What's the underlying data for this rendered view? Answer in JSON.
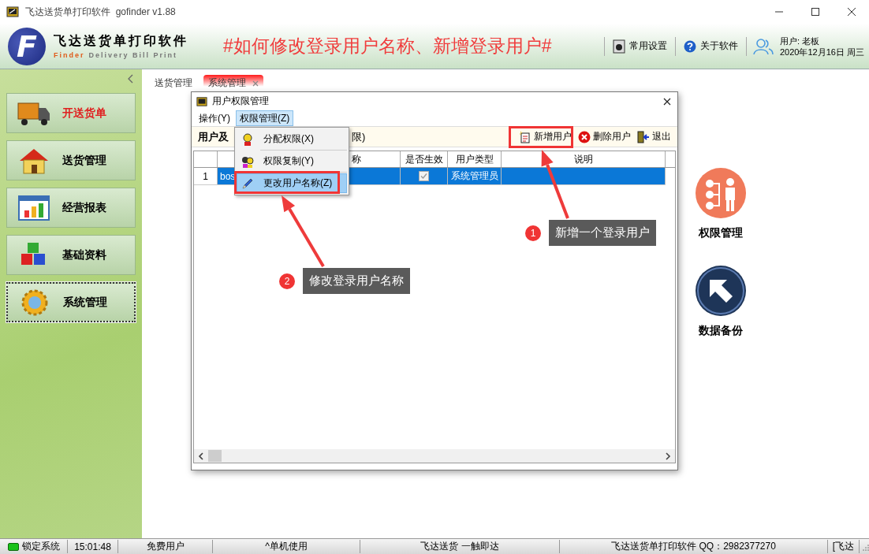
{
  "window": {
    "title": "飞达送货单打印软件  gofinder v1.88"
  },
  "header": {
    "logo_letter": "F",
    "brand_name": "飞达送货单打印软件",
    "brand_tagline_accent": "Finder",
    "brand_tagline": "Delivery Bill Print",
    "headline": "#如何修改登录用户名称、新增登录用户#",
    "tools": [
      {
        "label": "常用设置",
        "kind": "settings"
      },
      {
        "label": "关于软件",
        "kind": "help"
      }
    ],
    "user": "用户: 老板",
    "date": "2020年12月16日 周三"
  },
  "sidebar": {
    "items": [
      {
        "label": "开送货单",
        "kind": "truck",
        "selected": false,
        "color": "#e02020"
      },
      {
        "label": "送货管理",
        "kind": "house",
        "selected": false,
        "color": "#000000"
      },
      {
        "label": "经营报表",
        "kind": "chart",
        "selected": false,
        "color": "#000000"
      },
      {
        "label": "基础资料",
        "kind": "cubes",
        "selected": false,
        "color": "#000000"
      },
      {
        "label": "系统管理",
        "kind": "gear",
        "selected": true,
        "color": "#000000"
      }
    ]
  },
  "tabs": [
    {
      "label": "送货管理",
      "selected": false,
      "closable": false
    },
    {
      "label": "系统管理",
      "selected": true,
      "closable": true
    }
  ],
  "launchers": [
    {
      "label": "权限管理",
      "kind": "permissions"
    },
    {
      "label": "数据备份",
      "kind": "backup"
    }
  ],
  "dialog": {
    "title": "用户权限管理",
    "menus": [
      {
        "label": "操作(Y)",
        "selected": false
      },
      {
        "label": "权限管理(Z)",
        "selected": true
      }
    ],
    "dropdown": [
      {
        "label": "分配权限(X)",
        "kind": "assign",
        "selected": false
      },
      {
        "label": "权限复制(Y)",
        "kind": "copy",
        "selected": false
      },
      {
        "label": "更改用户名称(Z)",
        "kind": "rename",
        "selected": true
      }
    ],
    "toolbar_label": "用户及",
    "toolbar_label_tail": "限)",
    "buttons": [
      {
        "label": "新增用户",
        "kind": "add"
      },
      {
        "label": "删除用户",
        "kind": "delete"
      },
      {
        "label": "退出",
        "kind": "exit"
      }
    ],
    "table": {
      "columns": [
        {
          "kind": "index"
        },
        {
          "kind": "text"
        },
        {
          "kind": "text",
          "label": "称"
        },
        {
          "kind": "check",
          "label": "是否生效"
        },
        {
          "kind": "text",
          "label": "用户类型"
        },
        {
          "kind": "text",
          "label": "说明"
        }
      ],
      "rows": [
        {
          "selected": true,
          "active": true,
          "cells": [
            "1",
            "bos",
            "",
            "",
            "系统管理员",
            ""
          ]
        }
      ]
    }
  },
  "annotations": [
    {
      "number": "1",
      "text": "新增一个登录用户"
    },
    {
      "number": "2",
      "text": "修改登录用户名称"
    }
  ],
  "status_bar": [
    {
      "text": "锁定系统",
      "kind": "lock"
    },
    {
      "text": "15:01:48",
      "kind": "plain"
    },
    {
      "text": "免费用户",
      "kind": "plain"
    },
    {
      "text": "^单机使用",
      "kind": "plain"
    },
    {
      "text": "飞达送货 一触即达",
      "kind": "plain"
    },
    {
      "text": "飞达送货单打印软件 QQ：2982377270",
      "kind": "plain"
    },
    {
      "text": "[飞达",
      "kind": "plain"
    }
  ]
}
